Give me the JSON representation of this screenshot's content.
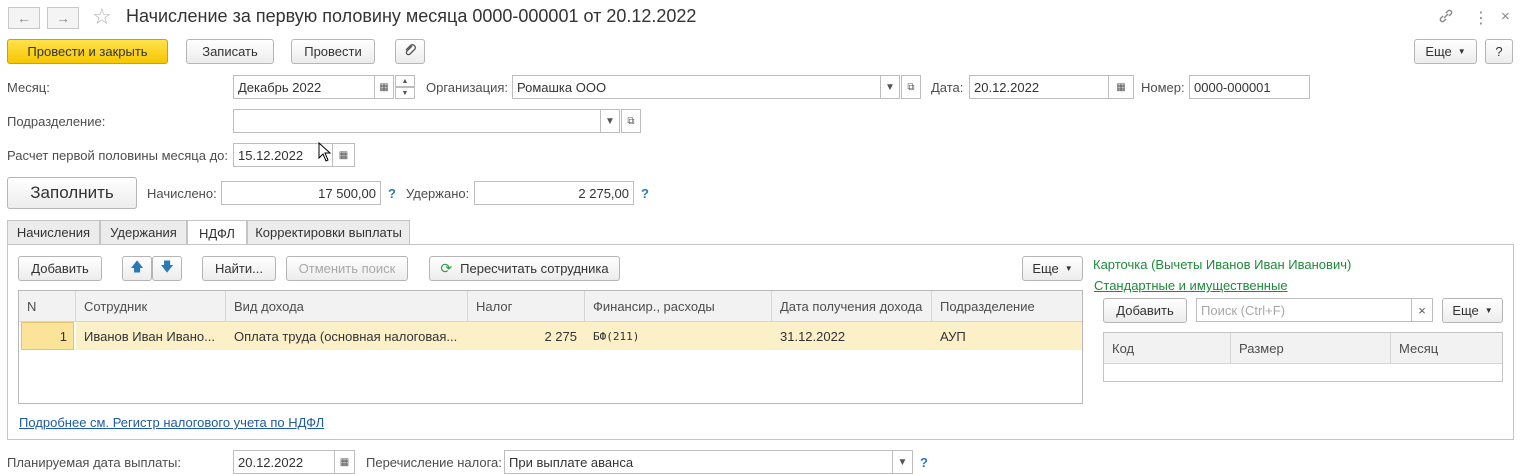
{
  "window": {
    "title": "Начисление за первую половину месяца 0000-000001 от 20.12.2022",
    "back_icon": "arrow-left-icon",
    "forward_icon": "arrow-right-icon",
    "favorite_icon": "star-icon",
    "link_icon": "link-icon",
    "more_icon": "vertical-dots-icon",
    "close_icon": "close-icon"
  },
  "toolbar": {
    "post_close": "Провести и закрыть",
    "save": "Записать",
    "post": "Провести",
    "attach_icon": "paperclip-icon",
    "more": "Еще",
    "help": "?"
  },
  "form": {
    "month_label": "Месяц:",
    "month_value": "Декабрь 2022",
    "org_label": "Организация:",
    "org_value": "Ромашка ООО",
    "date_label": "Дата:",
    "date_value": "20.12.2022",
    "number_label": "Номер:",
    "number_value": "0000-000001",
    "division_label": "Подразделение:",
    "division_value": "",
    "calc_label": "Расчет первой половины месяца до:",
    "calc_value": "15.12.2022",
    "fill_button": "Заполнить",
    "accrued_label": "Начислено:",
    "accrued_value": "17 500,00",
    "withheld_label": "Удержано:",
    "withheld_value": "2 275,00",
    "q": "?"
  },
  "tabs": [
    {
      "label": "Начисления",
      "active": false
    },
    {
      "label": "Удержания",
      "active": false
    },
    {
      "label": "НДФЛ",
      "active": true
    },
    {
      "label": "Корректировки выплаты",
      "active": false
    }
  ],
  "ndfl": {
    "add": "Добавить",
    "up_icon": "arrow-up-icon",
    "down_icon": "arrow-down-icon",
    "find": "Найти...",
    "cancel_search": "Отменить поиск",
    "recalc": "Пересчитать сотрудника",
    "more": "Еще",
    "columns": [
      "N",
      "Сотрудник",
      "Вид дохода",
      "Налог",
      "Финансир., расходы",
      "Дата получения дохода",
      "Подразделение"
    ],
    "rows": [
      [
        "1",
        "Иванов Иван Ивано...",
        "Оплата труда (основная налоговая...",
        "2 275",
        "БФ(211)",
        "31.12.2022",
        "АУП"
      ]
    ],
    "register_link": "Подробнее см. Регистр налогового учета по НДФЛ"
  },
  "card": {
    "title": "Карточка (Вычеты Иванов Иван Иванович)",
    "link": "Стандартные и имущественные",
    "add": "Добавить",
    "search_placeholder": "Поиск (Ctrl+F)",
    "more": "Еще",
    "columns": [
      "Код",
      "Размер",
      "Месяц"
    ]
  },
  "footer": {
    "plan_date_label": "Планируемая дата выплаты:",
    "plan_date_value": "20.12.2022",
    "tax_transfer_label": "Перечисление налога:",
    "tax_transfer_value": "При выплате аванса",
    "q": "?"
  },
  "colors": {
    "primary_button": "#f6c600",
    "selected_row": "#fbf0c8",
    "link_blue": "#1f5aa6",
    "link_green": "#1d8a3a"
  }
}
